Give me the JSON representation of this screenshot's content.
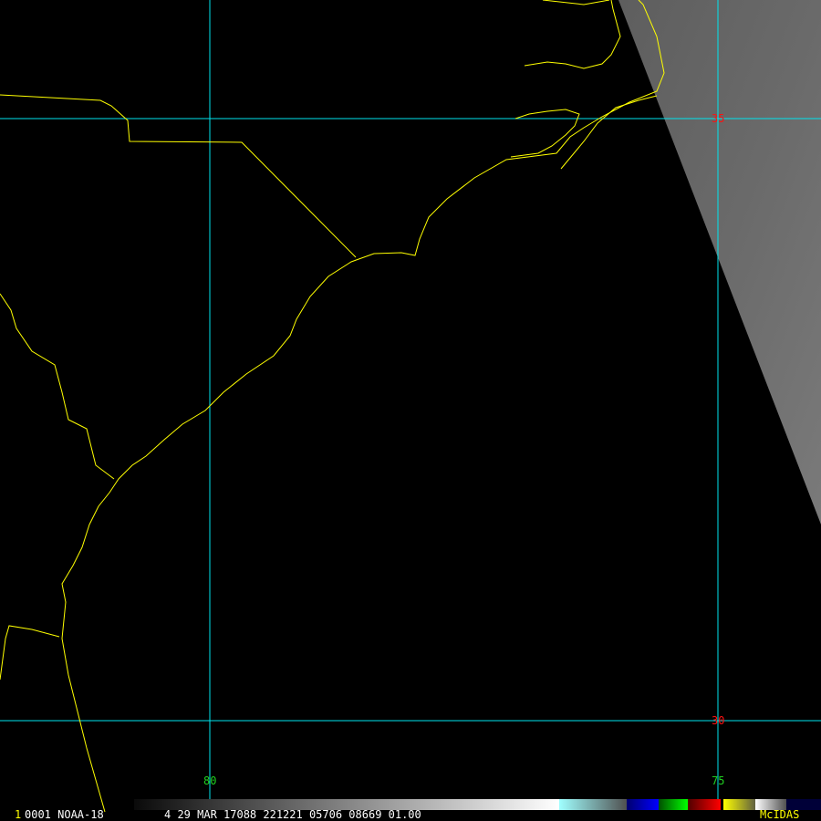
{
  "map": {
    "lat_labels": [
      "35",
      "30"
    ],
    "lon_labels": [
      "80",
      "75"
    ],
    "grid_color": "#00e5ee",
    "lat_label_color": "#ff1010",
    "lon_label_color": "#20d020",
    "border_color": "#ffff00"
  },
  "footer": {
    "frame_number": "1",
    "info": "0001 NOAA-18",
    "datetime": "4 29 MAR 17088 221221 05706 08669 01.00",
    "brand": "McIDAS"
  }
}
